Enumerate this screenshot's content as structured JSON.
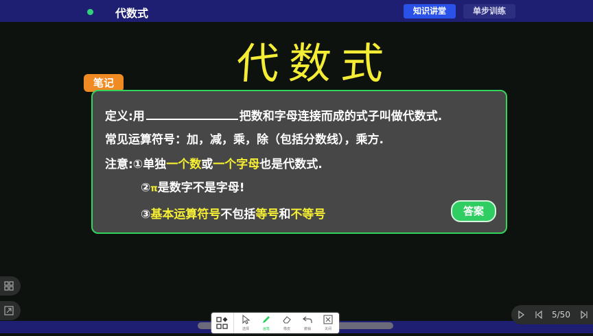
{
  "header": {
    "title": "代数式",
    "tabs": [
      {
        "label": "知识讲堂",
        "active": true
      },
      {
        "label": "单步训练",
        "active": false
      }
    ]
  },
  "board": {
    "handwritten_title": "代数式",
    "note_tag": "笔记",
    "card": {
      "line1_pre": "定义:用",
      "line1_post": "把数和字母连接而成的式子叫做代数式.",
      "line2": "常见运算符号：加，减，乘，除（包括分数线），乘方.",
      "line3_a": "注意:①单独",
      "line3_b": "一个数",
      "line3_c": "或",
      "line3_d": "一个字母",
      "line3_e": "也是代数式.",
      "line4_a": "②",
      "line4_b": "π",
      "line4_c": "是数字不是字母!",
      "line5_a": "③",
      "line5_b": "基本运算符号",
      "line5_c": "不包括",
      "line5_d": "等号",
      "line5_e": "和",
      "line5_f": "不等号",
      "answer_label": "答案"
    }
  },
  "toolbar": {
    "items": [
      {
        "label": "选择",
        "icon": "cursor-icon"
      },
      {
        "label": "画笔",
        "icon": "pen-icon"
      },
      {
        "label": "橡皮",
        "icon": "eraser-icon"
      },
      {
        "label": "撤销",
        "icon": "undo-icon"
      },
      {
        "label": "关闭",
        "icon": "close-icon"
      }
    ]
  },
  "navigation": {
    "page": "5/50"
  },
  "colors": {
    "header_bg": "#1e1f72",
    "accent_tab": "#2a52e8",
    "highlight": "#f7ef33",
    "card_border": "#33d65c",
    "note_tag": "#f08a22"
  }
}
